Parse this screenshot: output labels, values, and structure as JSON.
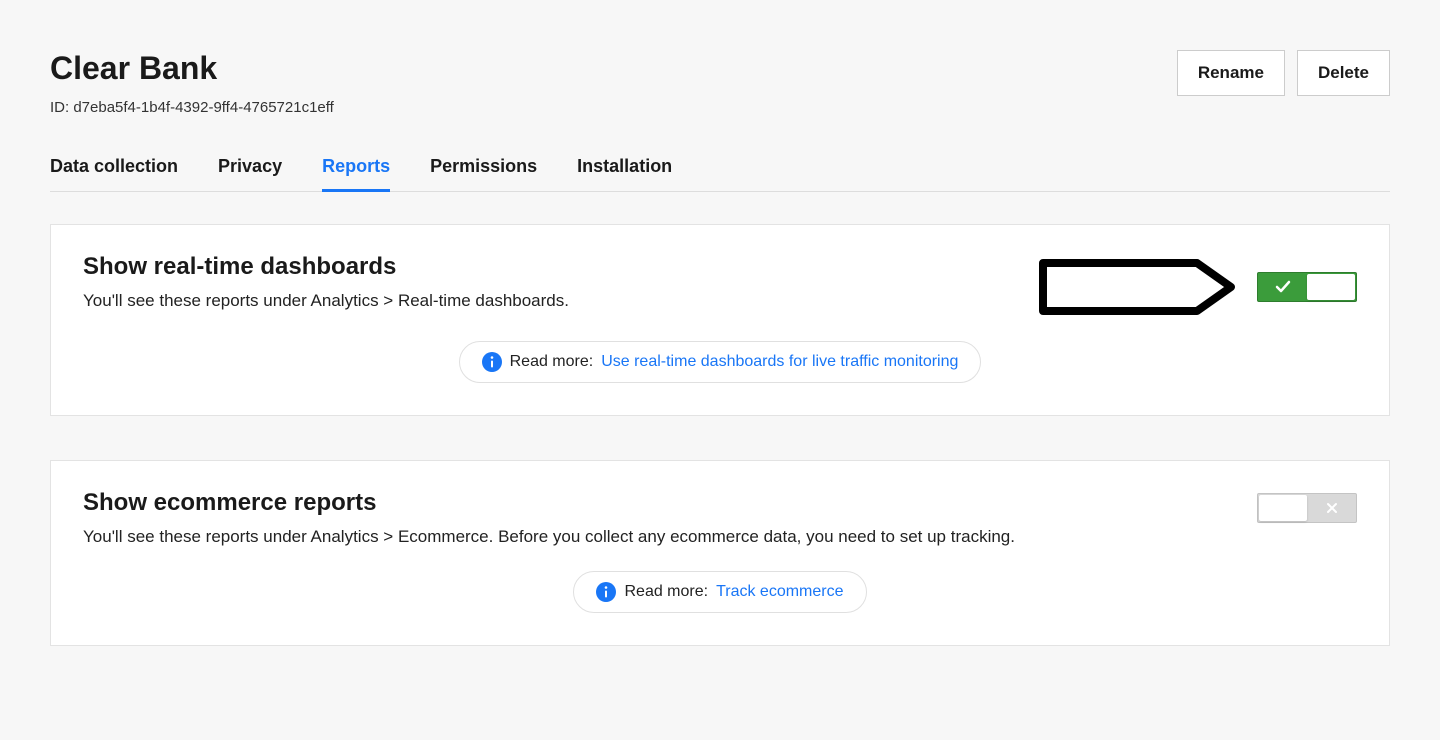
{
  "header": {
    "title": "Clear Bank",
    "id_label": "ID: d7eba5f4-1b4f-4392-9ff4-4765721c1eff",
    "rename_label": "Rename",
    "delete_label": "Delete"
  },
  "tabs": {
    "items": [
      {
        "label": "Data collection",
        "active": false
      },
      {
        "label": "Privacy",
        "active": false
      },
      {
        "label": "Reports",
        "active": true
      },
      {
        "label": "Permissions",
        "active": false
      },
      {
        "label": "Installation",
        "active": false
      }
    ]
  },
  "cards": {
    "realtime": {
      "title": "Show real-time dashboards",
      "description": "You'll see these reports under Analytics > Real-time dashboards.",
      "toggle_on": true,
      "read_more_prefix": "Read more:",
      "read_more_link": "Use real-time dashboards for live traffic monitoring"
    },
    "ecommerce": {
      "title": "Show ecommerce reports",
      "description": "You'll see these reports under Analytics > Ecommerce. Before you collect any ecommerce data, you need to set up tracking.",
      "toggle_on": false,
      "read_more_prefix": "Read more:",
      "read_more_link": "Track ecommerce"
    }
  },
  "colors": {
    "accent": "#1976f6",
    "toggle_on": "#3b9c3b",
    "toggle_off": "#d9d9d9"
  }
}
